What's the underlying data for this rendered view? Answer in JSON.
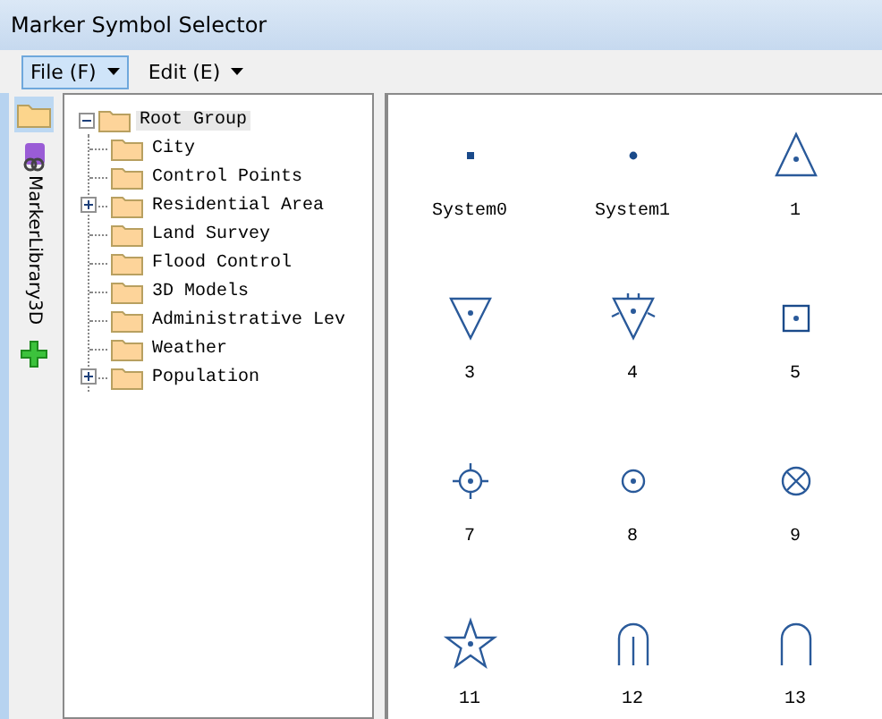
{
  "window": {
    "title": "Marker Symbol Selector"
  },
  "menu": [
    {
      "label": "File (F)",
      "selected": true
    },
    {
      "label": "Edit (E)",
      "selected": false
    }
  ],
  "libraries": [
    {
      "kind": "folder",
      "selected": true
    },
    {
      "kind": "library",
      "label": "MarkerLibrary3D",
      "selected": false
    },
    {
      "kind": "add",
      "selected": false
    }
  ],
  "tree": {
    "label": "Root Group",
    "expanded": true,
    "selected": true,
    "children": [
      {
        "label": "City",
        "expandable": false
      },
      {
        "label": "Control Points",
        "expandable": false
      },
      {
        "label": "Residential Area",
        "expandable": true
      },
      {
        "label": "Land Survey",
        "expandable": false
      },
      {
        "label": "Flood Control",
        "expandable": false
      },
      {
        "label": "3D Models",
        "expandable": false
      },
      {
        "label": "Administrative Lev",
        "expandable": false
      },
      {
        "label": "Weather",
        "expandable": false
      },
      {
        "label": "Population",
        "expandable": true
      }
    ]
  },
  "symbols": [
    {
      "kind": "square",
      "label": "System0"
    },
    {
      "kind": "dot",
      "label": "System1"
    },
    {
      "kind": "triangle",
      "label": "1"
    },
    {
      "kind": "triangle-down",
      "label": "3"
    },
    {
      "kind": "triangle-down-spiked",
      "label": "4"
    },
    {
      "kind": "box",
      "label": "5"
    },
    {
      "kind": "crosshair",
      "label": "7"
    },
    {
      "kind": "circle-dot",
      "label": "8"
    },
    {
      "kind": "circle-x",
      "label": "9"
    },
    {
      "kind": "star",
      "label": "11"
    },
    {
      "kind": "arch-line",
      "label": "12"
    },
    {
      "kind": "arch",
      "label": "13"
    }
  ]
}
